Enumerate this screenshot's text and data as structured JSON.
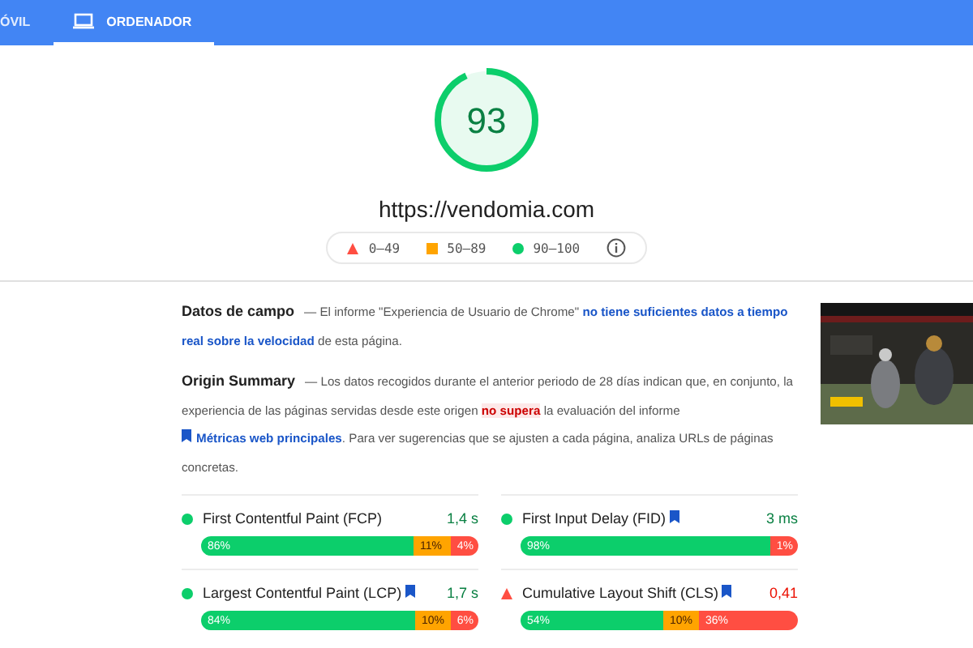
{
  "tabs": [
    {
      "label": "ÓVIL",
      "selected": false
    },
    {
      "label": "ORDENADOR",
      "selected": true
    }
  ],
  "gauge": {
    "score": "93",
    "level": 0.93,
    "url": "https://vendomia.com"
  },
  "legend": [
    {
      "kind": "poor",
      "label": "0–49"
    },
    {
      "kind": "average",
      "label": "50–89"
    },
    {
      "kind": "good",
      "label": "90–100"
    }
  ],
  "sections": [
    {
      "title": "Datos de campo",
      "parts": [
        {
          "kind": "text",
          "text": "— El informe \"Experiencia de Usuario de Chrome\" "
        },
        {
          "kind": "emphasis",
          "text": "no tiene suficientes datos a tiempo real sobre la velocidad"
        },
        {
          "kind": "text",
          "text": " de esta página."
        }
      ]
    },
    {
      "title": "Origin Summary",
      "parts": [
        {
          "kind": "text",
          "text": "— Los datos recogidos durante el anterior periodo de 28 días indican que, en conjunto, la experiencia de las páginas servidas desde este origen "
        },
        {
          "kind": "fail",
          "text": "no supera"
        },
        {
          "kind": "text",
          "text": " la evaluación del informe "
        },
        {
          "kind": "link",
          "text": "Métricas web principales"
        },
        {
          "kind": "text",
          "text": ". Para ver sugerencias que se ajusten a cada página, analiza URLs de páginas concretas."
        }
      ]
    }
  ],
  "metrics": [
    {
      "name": "First Contentful Paint (FCP)",
      "bookmark": false,
      "kind": "good",
      "value": "1,4 s",
      "segments": [
        {
          "kind": "good",
          "text": "86%"
        },
        {
          "kind": "average",
          "text": "11%"
        },
        {
          "kind": "poor",
          "text": "4%"
        }
      ]
    },
    {
      "name": "First Input Delay (FID)",
      "bookmark": true,
      "kind": "good",
      "value": "3 ms",
      "segments": [
        {
          "kind": "good",
          "text": "98%"
        },
        {
          "kind": "poor",
          "text": "1%"
        }
      ]
    },
    {
      "name": "Largest Contentful Paint (LCP)",
      "bookmark": true,
      "kind": "good",
      "value": "1,7 s",
      "segments": [
        {
          "kind": "good",
          "text": "84%"
        },
        {
          "kind": "average",
          "text": "10%"
        },
        {
          "kind": "poor",
          "text": "6%"
        }
      ]
    },
    {
      "name": "Cumulative Layout Shift (CLS)",
      "bookmark": true,
      "kind": "poor",
      "value": "0,41",
      "segments": [
        {
          "kind": "good",
          "text": "54%"
        },
        {
          "kind": "average",
          "text": "10%"
        },
        {
          "kind": "poor",
          "text": "36%"
        }
      ]
    }
  ]
}
